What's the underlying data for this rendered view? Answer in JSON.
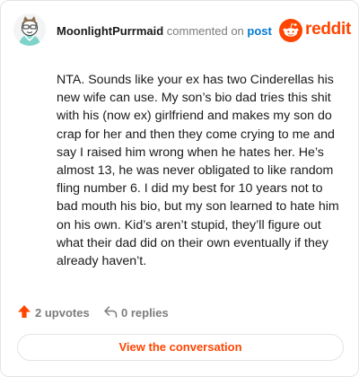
{
  "header": {
    "username": "MoonlightPurrmaid",
    "verb": "commented on",
    "post_link": "post",
    "brand": "reddit",
    "brand_color": "#ff4500"
  },
  "comment": {
    "text": "NTA. Sounds like your ex has two Cinderellas his new wife can use. My son’s bio dad tries this shit with his (now ex) girlfriend and makes my son do crap for her and then they come crying to me and say I raised him wrong when he hates her. He’s almost 13, he was never obligated to like random fling number 6. I did my best for 10 years not to bad mouth his bio, but my son learned to hate him on his own. Kid’s aren’t stupid, they’ll figure out what their dad did on their own eventually if they already haven’t."
  },
  "actions": {
    "upvotes_label": "2 upvotes",
    "upvote_icon": "upvote-arrow-icon",
    "upvote_color": "#ff4500",
    "replies_label": "0 replies",
    "reply_icon": "reply-arrow-icon"
  },
  "cta": {
    "label": "View the conversation"
  },
  "colors": {
    "link_blue": "#0079d3",
    "muted_gray": "#7c7c7c",
    "border": "#e2e4e6"
  }
}
